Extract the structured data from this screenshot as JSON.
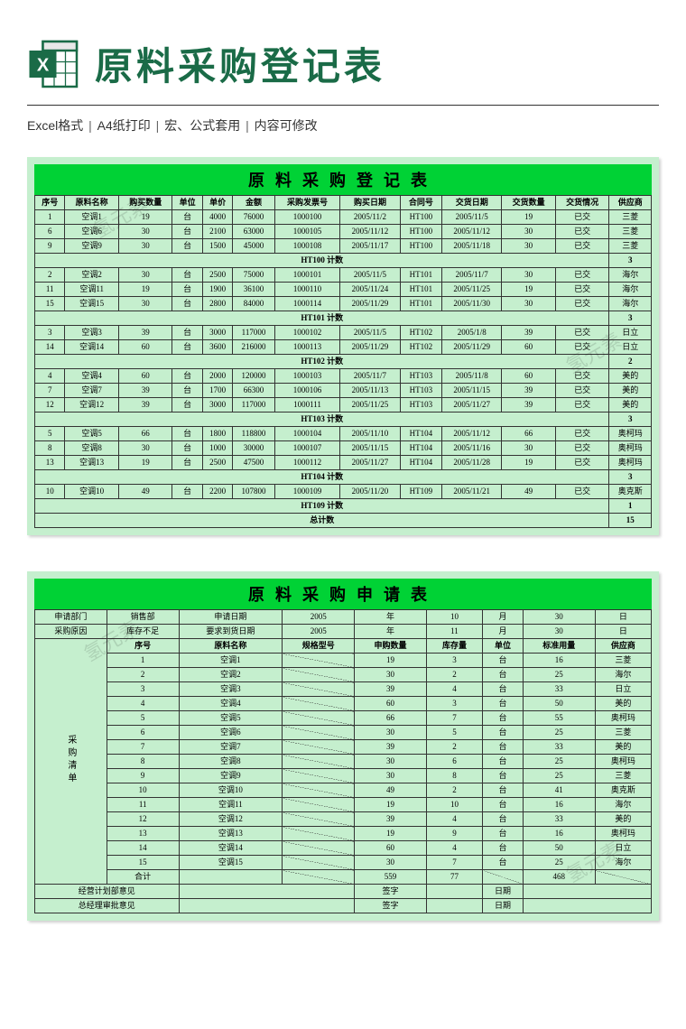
{
  "header": {
    "title": "原料采购登记表",
    "meta": [
      "Excel格式",
      "A4纸打印",
      "宏、公式套用",
      "内容可修改"
    ]
  },
  "watermark": "氢元素",
  "sheet1": {
    "title": "原料采购登记表",
    "cols": [
      "序号",
      "原料名称",
      "购买数量",
      "单位",
      "单价",
      "金额",
      "采购发票号",
      "购买日期",
      "合同号",
      "交货日期",
      "交货数量",
      "交货情况",
      "供应商"
    ],
    "groups": [
      {
        "name": "HT100 计数",
        "count": "3",
        "rows": [
          [
            "1",
            "空调1",
            "19",
            "台",
            "4000",
            "76000",
            "1000100",
            "2005/11/2",
            "HT100",
            "2005/11/5",
            "19",
            "已交",
            "三菱"
          ],
          [
            "6",
            "空调6",
            "30",
            "台",
            "2100",
            "63000",
            "1000105",
            "2005/11/12",
            "HT100",
            "2005/11/12",
            "30",
            "已交",
            "三菱"
          ],
          [
            "9",
            "空调9",
            "30",
            "台",
            "1500",
            "45000",
            "1000108",
            "2005/11/17",
            "HT100",
            "2005/11/18",
            "30",
            "已交",
            "三菱"
          ]
        ]
      },
      {
        "name": "HT101 计数",
        "count": "3",
        "rows": [
          [
            "2",
            "空调2",
            "30",
            "台",
            "2500",
            "75000",
            "1000101",
            "2005/11/5",
            "HT101",
            "2005/11/7",
            "30",
            "已交",
            "海尔"
          ],
          [
            "11",
            "空调11",
            "19",
            "台",
            "1900",
            "36100",
            "1000110",
            "2005/11/24",
            "HT101",
            "2005/11/25",
            "19",
            "已交",
            "海尔"
          ],
          [
            "15",
            "空调15",
            "30",
            "台",
            "2800",
            "84000",
            "1000114",
            "2005/11/29",
            "HT101",
            "2005/11/30",
            "30",
            "已交",
            "海尔"
          ]
        ]
      },
      {
        "name": "HT102 计数",
        "count": "2",
        "rows": [
          [
            "3",
            "空调3",
            "39",
            "台",
            "3000",
            "117000",
            "1000102",
            "2005/11/5",
            "HT102",
            "2005/1/8",
            "39",
            "已交",
            "日立"
          ],
          [
            "14",
            "空调14",
            "60",
            "台",
            "3600",
            "216000",
            "1000113",
            "2005/11/29",
            "HT102",
            "2005/11/29",
            "60",
            "已交",
            "日立"
          ]
        ]
      },
      {
        "name": "HT103 计数",
        "count": "3",
        "rows": [
          [
            "4",
            "空调4",
            "60",
            "台",
            "2000",
            "120000",
            "1000103",
            "2005/11/7",
            "HT103",
            "2005/11/8",
            "60",
            "已交",
            "美的"
          ],
          [
            "7",
            "空调7",
            "39",
            "台",
            "1700",
            "66300",
            "1000106",
            "2005/11/13",
            "HT103",
            "2005/11/15",
            "39",
            "已交",
            "美的"
          ],
          [
            "12",
            "空调12",
            "39",
            "台",
            "3000",
            "117000",
            "1000111",
            "2005/11/25",
            "HT103",
            "2005/11/27",
            "39",
            "已交",
            "美的"
          ]
        ]
      },
      {
        "name": "HT104 计数",
        "count": "3",
        "rows": [
          [
            "5",
            "空调5",
            "66",
            "台",
            "1800",
            "118800",
            "1000104",
            "2005/11/10",
            "HT104",
            "2005/11/12",
            "66",
            "已交",
            "奥柯玛"
          ],
          [
            "8",
            "空调8",
            "30",
            "台",
            "1000",
            "30000",
            "1000107",
            "2005/11/15",
            "HT104",
            "2005/11/16",
            "30",
            "已交",
            "奥柯玛"
          ],
          [
            "13",
            "空调13",
            "19",
            "台",
            "2500",
            "47500",
            "1000112",
            "2005/11/27",
            "HT104",
            "2005/11/28",
            "19",
            "已交",
            "奥柯玛"
          ]
        ]
      },
      {
        "name": "HT109 计数",
        "count": "1",
        "rows": [
          [
            "10",
            "空调10",
            "49",
            "台",
            "2200",
            "107800",
            "1000109",
            "2005/11/20",
            "HT109",
            "2005/11/21",
            "49",
            "已交",
            "奥克斯"
          ]
        ]
      }
    ],
    "grand_label": "总计数",
    "grand_value": "15"
  },
  "sheet2": {
    "title": "原料采购申请表",
    "info1": {
      "dept_label": "申请部门",
      "dept": "销售部",
      "apply_date_label": "申请日期",
      "y": "2005",
      "yl": "年",
      "m": "10",
      "ml": "月",
      "d": "30",
      "dl": "日"
    },
    "info2": {
      "reason_label": "采购原因",
      "reason": "库存不足",
      "req_date_label": "要求到货日期",
      "y": "2005",
      "yl": "年",
      "m": "11",
      "ml": "月",
      "d": "30",
      "dl": "日"
    },
    "cols": [
      "序号",
      "原料名称",
      "规格型号",
      "申购数量",
      "库存量",
      "单位",
      "标准用量",
      "供应商"
    ],
    "side_label": "采购清单",
    "rows": [
      [
        "1",
        "空调1",
        "",
        "19",
        "3",
        "台",
        "16",
        "三菱"
      ],
      [
        "2",
        "空调2",
        "",
        "30",
        "2",
        "台",
        "25",
        "海尔"
      ],
      [
        "3",
        "空调3",
        "",
        "39",
        "4",
        "台",
        "33",
        "日立"
      ],
      [
        "4",
        "空调4",
        "",
        "60",
        "3",
        "台",
        "50",
        "美的"
      ],
      [
        "5",
        "空调5",
        "",
        "66",
        "7",
        "台",
        "55",
        "奥柯玛"
      ],
      [
        "6",
        "空调6",
        "",
        "30",
        "5",
        "台",
        "25",
        "三菱"
      ],
      [
        "7",
        "空调7",
        "",
        "39",
        "2",
        "台",
        "33",
        "美的"
      ],
      [
        "8",
        "空调8",
        "",
        "30",
        "6",
        "台",
        "25",
        "奥柯玛"
      ],
      [
        "9",
        "空调9",
        "",
        "30",
        "8",
        "台",
        "25",
        "三菱"
      ],
      [
        "10",
        "空调10",
        "",
        "49",
        "2",
        "台",
        "41",
        "奥克斯"
      ],
      [
        "11",
        "空调11",
        "",
        "19",
        "10",
        "台",
        "16",
        "海尔"
      ],
      [
        "12",
        "空调12",
        "",
        "39",
        "4",
        "台",
        "33",
        "美的"
      ],
      [
        "13",
        "空调13",
        "",
        "19",
        "9",
        "台",
        "16",
        "奥柯玛"
      ],
      [
        "14",
        "空调14",
        "",
        "60",
        "4",
        "台",
        "50",
        "日立"
      ],
      [
        "15",
        "空调15",
        "",
        "30",
        "7",
        "台",
        "25",
        "海尔"
      ]
    ],
    "total": {
      "label": "合计",
      "qty": "559",
      "stock": "77",
      "std": "468"
    },
    "approve1_label": "经营计划部意见",
    "approve2_label": "总经理审批意见",
    "sign_label": "签字",
    "date_label": "日期"
  }
}
